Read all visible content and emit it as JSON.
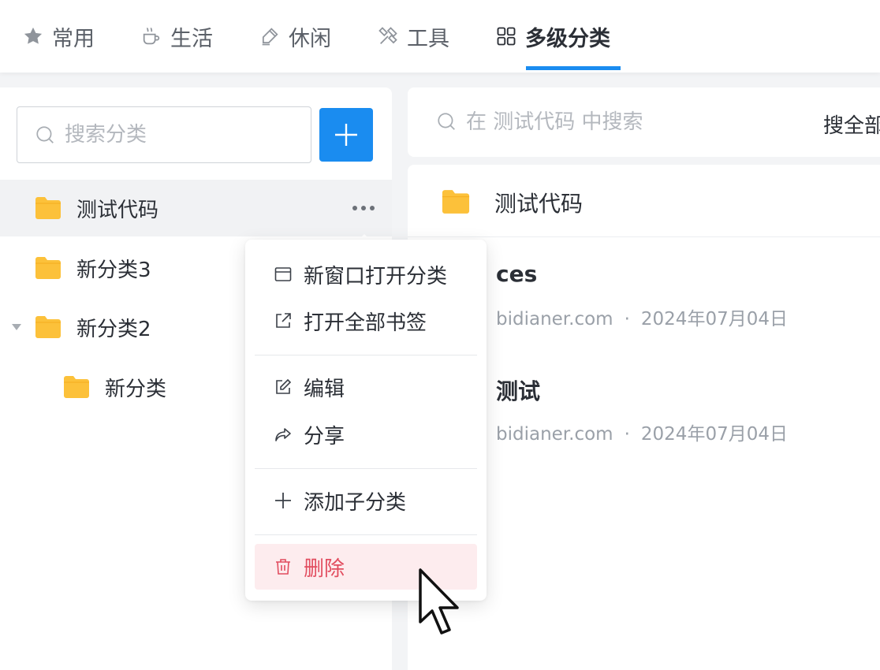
{
  "tabs": [
    {
      "label": "常用",
      "icon": "star-icon",
      "active": false
    },
    {
      "label": "生活",
      "icon": "coffee-cup-icon",
      "active": false
    },
    {
      "label": "休闲",
      "icon": "pen-icon",
      "active": false
    },
    {
      "label": "工具",
      "icon": "tools-icon",
      "active": false
    },
    {
      "label": "多级分类",
      "icon": "grid-icon",
      "active": true
    }
  ],
  "sidebar": {
    "search_placeholder": "搜索分类",
    "add_icon": "plus-icon",
    "items": [
      {
        "label": "测试代码",
        "level": 0,
        "selected": true
      },
      {
        "label": "新分类3",
        "level": 0,
        "selected": false
      },
      {
        "label": "新分类2",
        "level": 0,
        "selected": false,
        "expanded": true
      },
      {
        "label": "新分类",
        "level": 1,
        "selected": false
      }
    ]
  },
  "main": {
    "search_placeholder": "在 测试代码 中搜索",
    "search_all": "搜全部",
    "folder_title": "测试代码",
    "bookmarks": [
      {
        "title": "ces",
        "domain": "bidianer.com",
        "date": "2024年07月04日"
      },
      {
        "title": "测试",
        "domain": "bidianer.com",
        "date": "2024年07月04日"
      }
    ],
    "meta_separator": "·"
  },
  "context_menu": {
    "groups": [
      [
        {
          "label": "新窗口打开分类",
          "icon": "window-icon"
        },
        {
          "label": "打开全部书签",
          "icon": "external-link-icon"
        }
      ],
      [
        {
          "label": "编辑",
          "icon": "edit-icon"
        },
        {
          "label": "分享",
          "icon": "share-icon"
        }
      ],
      [
        {
          "label": "添加子分类",
          "icon": "plus-icon"
        }
      ],
      [
        {
          "label": "删除",
          "icon": "trash-icon",
          "danger": true
        }
      ]
    ]
  },
  "colors": {
    "accent": "#1a8cf0",
    "folder": "#fcc13a",
    "danger_text": "#e24d5f",
    "danger_bg": "#fdecee"
  }
}
